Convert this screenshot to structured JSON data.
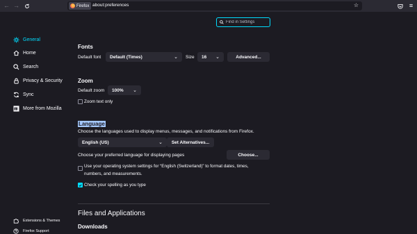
{
  "toolbar": {
    "identity_label": "Firefox",
    "url": "about:preferences"
  },
  "search": {
    "placeholder": "Find in Settings"
  },
  "sidebar": {
    "items": [
      {
        "label": "General",
        "icon": "gear-icon",
        "selected": true
      },
      {
        "label": "Home",
        "icon": "home-icon"
      },
      {
        "label": "Search",
        "icon": "search-icon"
      },
      {
        "label": "Privacy & Security",
        "icon": "lock-icon"
      },
      {
        "label": "Sync",
        "icon": "sync-icon"
      },
      {
        "label": "More from Mozilla",
        "icon": "mozilla-icon"
      }
    ],
    "footer": [
      {
        "label": "Extensions & Themes",
        "icon": "puzzle-icon"
      },
      {
        "label": "Firefox Support",
        "icon": "help-icon"
      }
    ]
  },
  "fonts": {
    "heading": "Fonts",
    "default_font_label": "Default font",
    "default_font_value": "Default (Times)",
    "size_label": "Size",
    "size_value": "16",
    "advanced_button": "Advanced..."
  },
  "zoom": {
    "heading": "Zoom",
    "default_zoom_label": "Default zoom",
    "default_zoom_value": "100%",
    "zoom_text_only_label": "Zoom text only",
    "zoom_text_only_checked": false
  },
  "language": {
    "heading": "Language",
    "description": "Choose the languages used to display menus, messages, and notifications from Firefox.",
    "language_value": "English (US)",
    "set_alternatives_button": "Set Alternatives...",
    "pages_label": "Choose your preferred language for displaying pages",
    "choose_button": "Choose...",
    "os_settings_line1": "Use your operating system settings for “English (Switzerland)” to format dates, times,",
    "os_settings_line2": "numbers, and measurements.",
    "os_settings_checked": false,
    "spelling_label": "Check your spelling as you type",
    "spelling_checked": true
  },
  "files": {
    "heading": "Files and Applications",
    "downloads_heading": "Downloads"
  },
  "colors": {
    "accent": "#00ddff",
    "background": "#1c1b22",
    "toolbar": "#2b2a33",
    "button": "#2b2a33"
  }
}
